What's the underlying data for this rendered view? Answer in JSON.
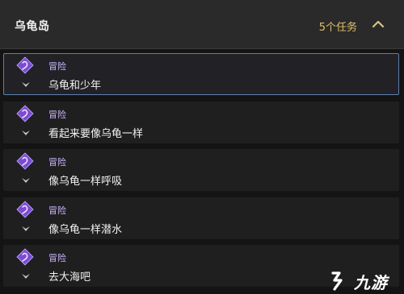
{
  "header": {
    "title": "乌龟岛",
    "task_count": "5个任务",
    "collapse_icon": "chevron-up-icon"
  },
  "quests": [
    {
      "category": "冒险",
      "title": "乌龟和少年",
      "selected": true
    },
    {
      "category": "冒险",
      "title": "看起来要像乌龟一样",
      "selected": false
    },
    {
      "category": "冒险",
      "title": "像乌龟一样呼吸",
      "selected": false
    },
    {
      "category": "冒险",
      "title": "像乌龟一样潜水",
      "selected": false
    },
    {
      "category": "冒险",
      "title": "去大海吧",
      "selected": false
    }
  ],
  "icons": {
    "quest_type": "adventure-diamond-icon",
    "quest_rank": "rank-chevron-icon"
  },
  "watermark": {
    "text": "九游"
  },
  "colors": {
    "accent_gold": "#e1c06d",
    "category_purple": "#c8b4ff",
    "icon_purple": "#7b4bd1",
    "selected_outline": "#5d7fb0"
  }
}
